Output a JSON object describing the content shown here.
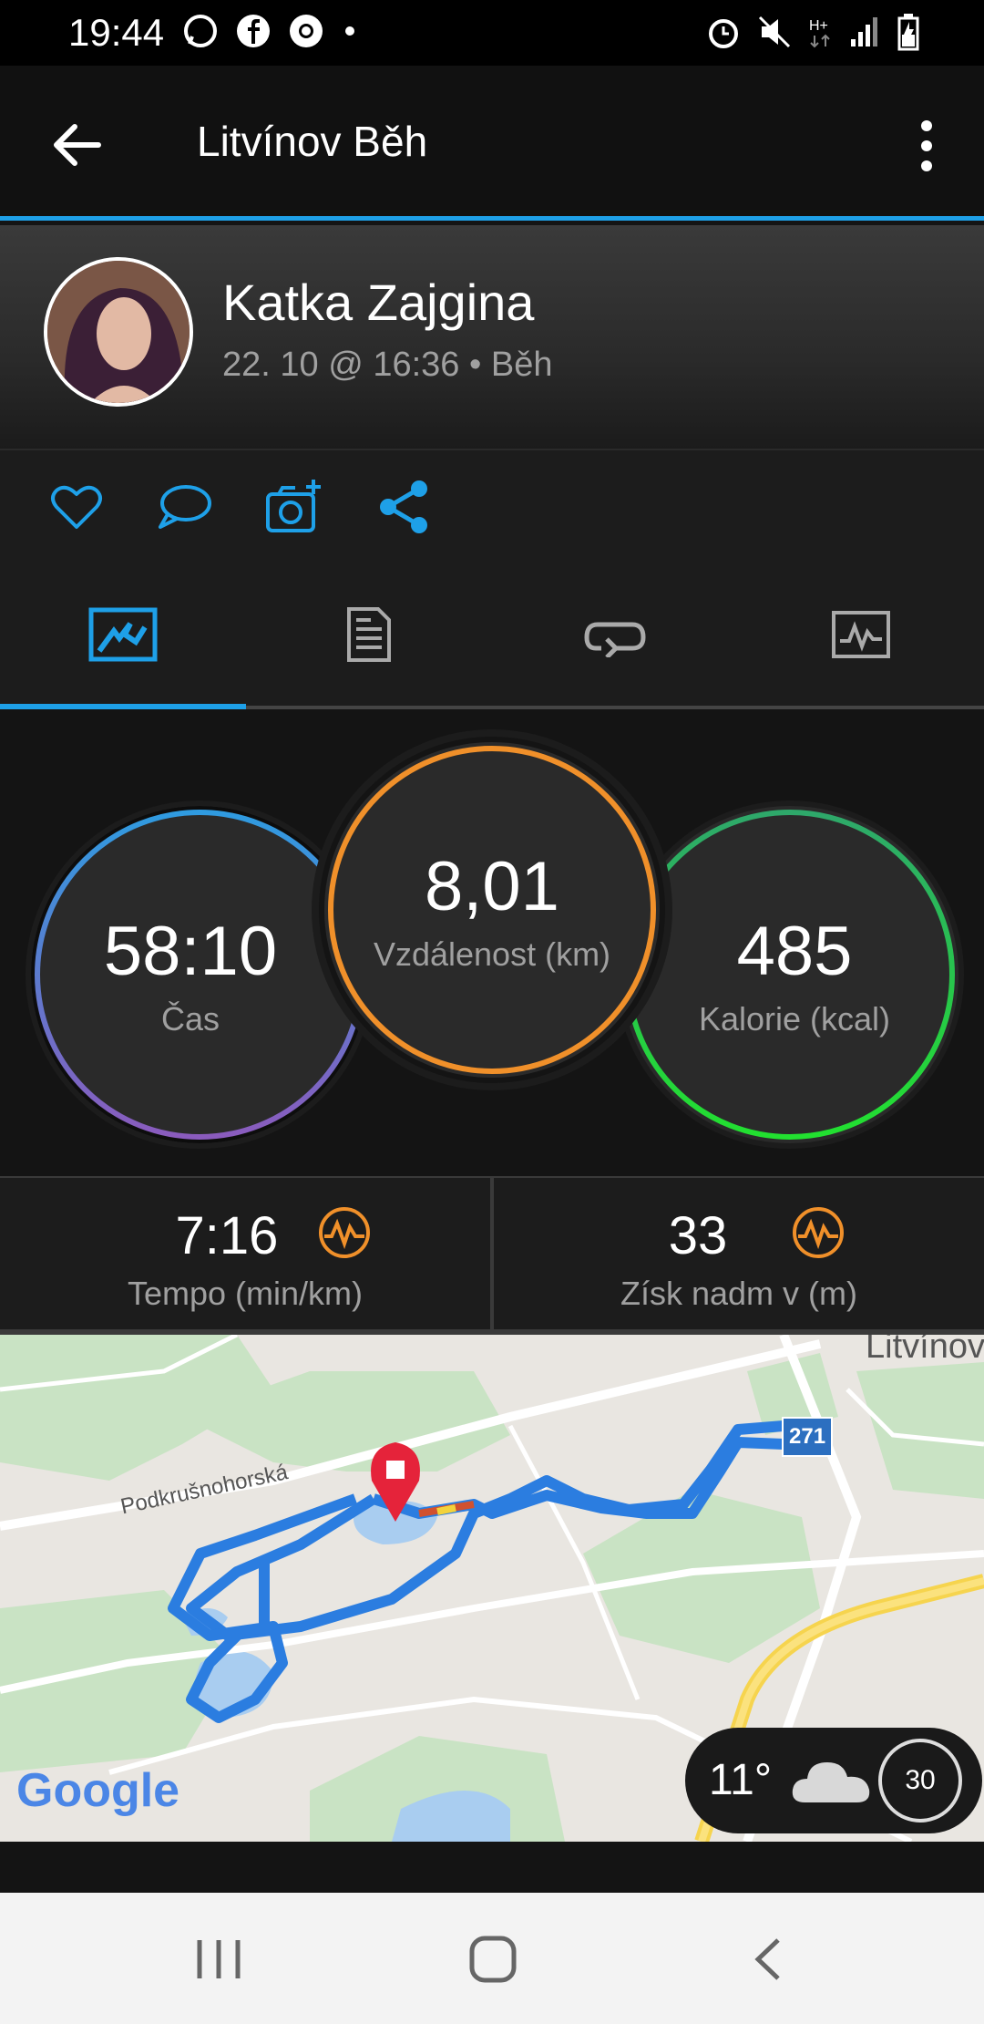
{
  "status_bar": {
    "time": "19:44",
    "left_icons": [
      "whatsapp-icon",
      "facebook-icon",
      "chrome-icon",
      "dot-icon"
    ],
    "right_icons": [
      "alarm-icon",
      "mute-icon",
      "hplus-data-icon",
      "signal-icon",
      "battery-charging-icon"
    ]
  },
  "app_bar": {
    "title": "Litvínov Běh",
    "accent_color": "#1ea0e8"
  },
  "profile": {
    "name": "Katka Zajgina",
    "meta": "22. 10 @ 16:36 • Běh"
  },
  "actions": [
    "like-icon",
    "comment-icon",
    "add-photo-icon",
    "share-icon"
  ],
  "tabs": [
    {
      "icon": "map-stats-icon",
      "active": true
    },
    {
      "icon": "details-icon",
      "active": false
    },
    {
      "icon": "laps-icon",
      "active": false
    },
    {
      "icon": "charts-icon",
      "active": false
    }
  ],
  "stats": {
    "time": {
      "value": "58:10",
      "label": "Čas"
    },
    "distance": {
      "value": "8,01",
      "label": "Vzdálenost (km)"
    },
    "calories": {
      "value": "485",
      "label": "Kalorie (kcal)"
    }
  },
  "metrics": {
    "pace": {
      "value": "7:16",
      "label": "Tempo (min/km)"
    },
    "elevation": {
      "value": "33",
      "label": "Získ nadm v (m)"
    }
  },
  "map": {
    "road_label": "Podkrušnohorská",
    "town_label": "Litvínov",
    "route_number": "271",
    "attribution": "Google"
  },
  "weather": {
    "temperature": "11°",
    "wind": "30",
    "condition_icon": "cloud-icon"
  },
  "nav_bar": [
    "recents-icon",
    "home-icon",
    "back-nav-icon"
  ]
}
